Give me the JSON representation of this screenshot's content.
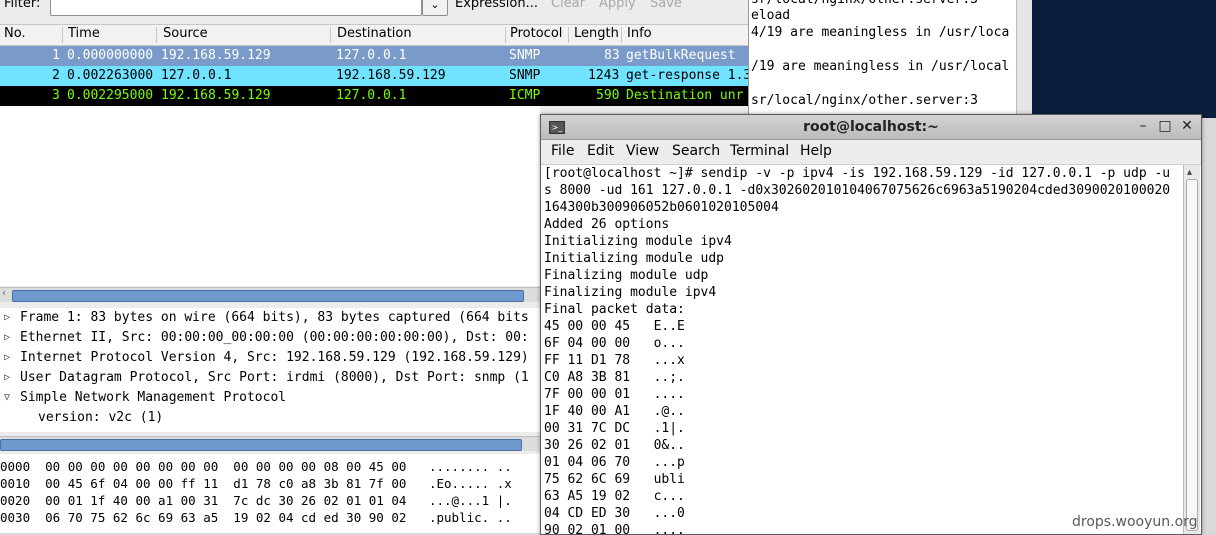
{
  "wireshark": {
    "filter_label": "Filter:",
    "filter_value": "",
    "toolbar": [
      "Expression...",
      "Clear",
      "Apply",
      "Save"
    ],
    "columns": [
      "No.",
      "Time",
      "Source",
      "Destination",
      "Protocol",
      "Length",
      "Info"
    ],
    "packets": [
      {
        "no": "1",
        "time": "0.000000000",
        "src": "192.168.59.129",
        "dst": "127.0.0.1",
        "proto": "SNMP",
        "len": "83",
        "info": "getBulkRequest"
      },
      {
        "no": "2",
        "time": "0.002263000",
        "src": "127.0.0.1",
        "dst": "192.168.59.129",
        "proto": "SNMP",
        "len": "1243",
        "info": "get-response 1.3"
      },
      {
        "no": "3",
        "time": "0.002295000",
        "src": "192.168.59.129",
        "dst": "127.0.0.1",
        "proto": "ICMP",
        "len": "590",
        "info": "Destination unr"
      }
    ],
    "details": [
      {
        "text": "Frame 1: 83 bytes on wire (664 bits), 83 bytes captured (664 bits",
        "expanded": false
      },
      {
        "text": "Ethernet II, Src: 00:00:00_00:00:00 (00:00:00:00:00:00), Dst: 00:",
        "expanded": false
      },
      {
        "text": "Internet Protocol Version 4, Src: 192.168.59.129 (192.168.59.129)",
        "expanded": false
      },
      {
        "text": "User Datagram Protocol, Src Port: irdmi (8000), Dst Port: snmp (1",
        "expanded": false
      },
      {
        "text": "Simple Network Management Protocol",
        "expanded": true
      },
      {
        "text": "version: v2c (1)",
        "expanded": null
      }
    ],
    "bytes": [
      "0000  00 00 00 00 00 00 00 00  00 00 00 00 08 00 45 00   ........ ..",
      "0010  00 45 6f 04 00 00 ff 11  d1 78 c0 a8 3b 81 7f 00   .Eo..... .x",
      "0020  00 01 1f 40 00 a1 00 31  7c dc 30 26 02 01 01 04   ...@...1 |.",
      "0030  06 70 75 62 6c 69 63 a5  19 02 04 cd ed 30 90 02   .public. .."
    ]
  },
  "bg_terminal": {
    "lines": [
      "sr/local/nginx/other.server:3",
      "eload",
      "4/19 are meaningless in /usr/loca",
      "",
      "/19 are meaningless in /usr/local",
      "",
      "sr/local/nginx/other.server:3"
    ]
  },
  "terminal": {
    "title": "root@localhost:~",
    "menu": [
      "File",
      "Edit",
      "View",
      "Search",
      "Terminal",
      "Help"
    ],
    "lines": [
      "[root@localhost ~]# sendip -v -p ipv4 -is 192.168.59.129 -id 127.0.0.1 -p udp -u",
      "s 8000 -ud 161 127.0.0.1 -d0x302602010104067075626c6963a5190204cded3090020100020",
      "164300b300906052b0601020105004",
      "Added 26 options",
      "Initializing module ipv4",
      "Initializing module udp",
      "Finalizing module udp",
      "Finalizing module ipv4",
      "Final packet data:",
      "45 00 00 45   E..E",
      "6F 04 00 00   o...",
      "FF 11 D1 78   ...x",
      "C0 A8 3B 81   ..;.",
      "7F 00 00 01   ....",
      "1F 40 00 A1   .@..",
      "00 31 7C DC   .1|.",
      "30 26 02 01   0&..",
      "01 04 06 70   ...p",
      "75 62 6C 69   ubli",
      "63 A5 19 02   c...",
      "04 CD ED 30   ...0",
      "90 02 01 00   ...."
    ]
  },
  "watermark": "drops.wooyun.org"
}
